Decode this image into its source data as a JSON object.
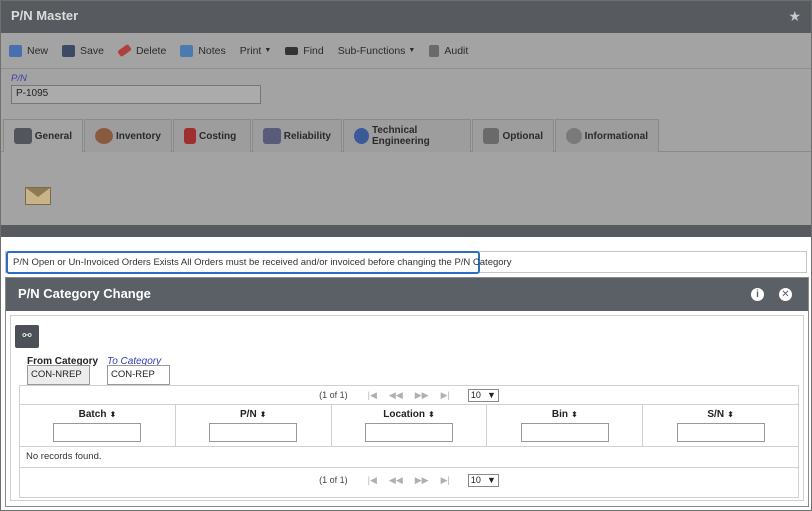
{
  "window": {
    "title": "P/N Master"
  },
  "toolbar": {
    "items": [
      {
        "label": "New",
        "icon": "new-icon",
        "color": "#4a6fb0"
      },
      {
        "label": "Save",
        "icon": "save-icon",
        "color": "#3d4a66"
      },
      {
        "label": "Delete",
        "icon": "delete-icon",
        "color": "#b04040"
      },
      {
        "label": "Notes",
        "icon": "notes-icon",
        "color": "#4a7ab0"
      },
      {
        "label": "Print",
        "icon": "",
        "dropdown": true
      },
      {
        "label": "Find",
        "icon": "binoculars-icon",
        "color": "#333"
      },
      {
        "label": "Sub-Functions",
        "icon": "",
        "dropdown": true
      },
      {
        "label": "Audit",
        "icon": "audit-icon",
        "color": "#6a6a6a"
      }
    ]
  },
  "pn": {
    "label": "P/N",
    "value": "P-1095"
  },
  "tabs": [
    {
      "label": "General",
      "icon": "general-icon",
      "active": true
    },
    {
      "label": "Inventory",
      "icon": "inventory-icon"
    },
    {
      "label": "Costing",
      "icon": "costing-icon"
    },
    {
      "label": "Reliability",
      "icon": "reliability-icon"
    },
    {
      "label": "Technical Engineering",
      "icon": "technical-engineering-icon"
    },
    {
      "label": "Optional",
      "icon": "optional-icon"
    },
    {
      "label": "Informational",
      "icon": "informational-icon"
    }
  ],
  "message": "P/N Open or Un-Invoiced Orders Exists All Orders must be received and/or invoiced before changing the P/N Category",
  "dialog": {
    "title": "P/N Category Change",
    "from_label": "From Category",
    "from_value": "CON-NREP",
    "to_label": "To Category",
    "to_value": "CON-REP",
    "pager": {
      "text": "(1 of 1)",
      "rows_per_page": "10"
    },
    "columns": [
      "Batch",
      "P/N",
      "Location",
      "Bin",
      "S/N"
    ],
    "empty_text": "No records found."
  },
  "colors": {
    "header": "#5b6067",
    "accent": "#2c6fc0",
    "dim": "#a3a3a3"
  }
}
